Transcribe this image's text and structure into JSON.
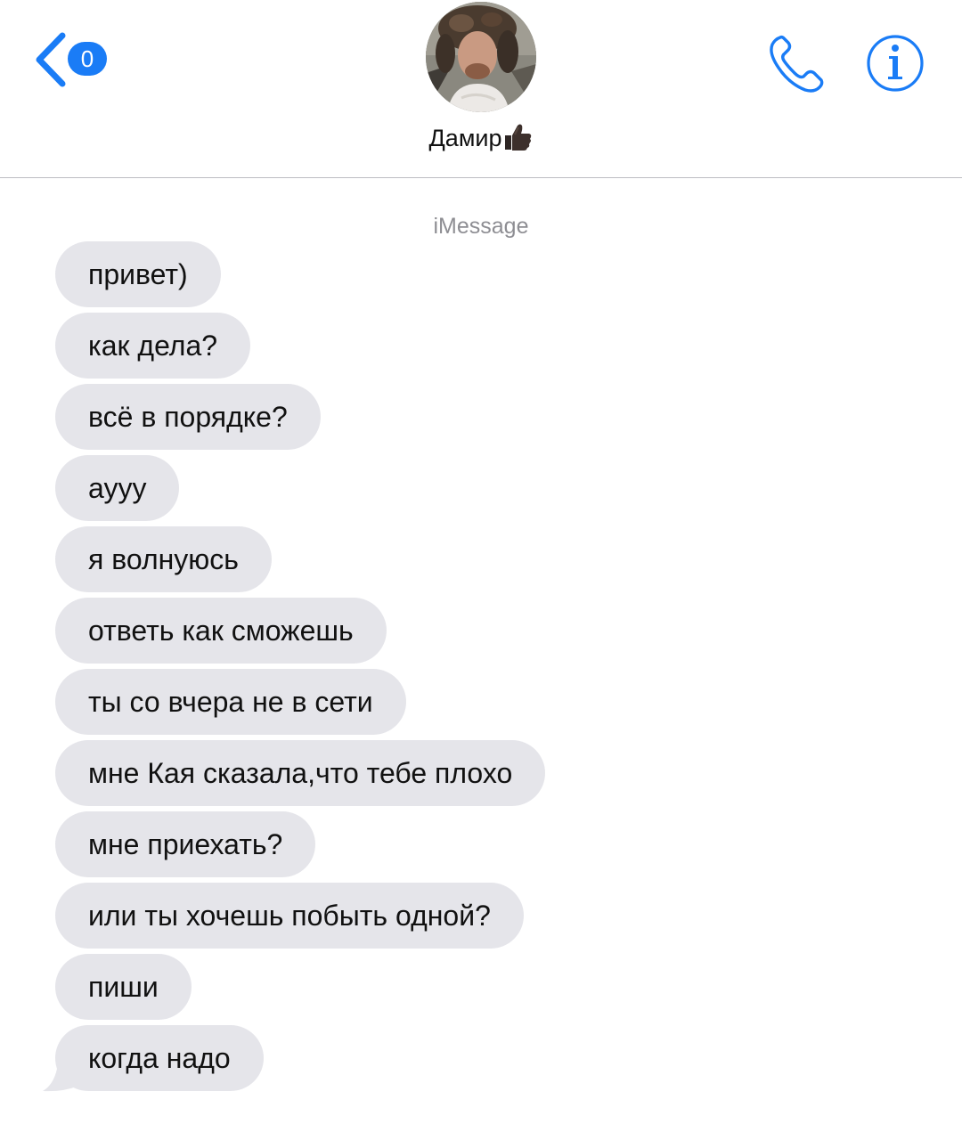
{
  "header": {
    "back_badge": "0",
    "contact_name": "Дамир"
  },
  "conversation": {
    "service_label": "iMessage",
    "messages": [
      "привет)",
      "как дела?",
      "всё в порядке?",
      "аууу",
      "я волнуюсь",
      "ответь как сможешь",
      "ты со вчера не в сети",
      "мне Кая сказала,что тебе плохо",
      "мне приехать?",
      "или ты хочешь побыть одной?",
      "пиши",
      "когда надо"
    ]
  },
  "colors": {
    "accent": "#1a7cf6",
    "bubble_incoming": "#e5e5ea",
    "service_label": "#8e8e93"
  },
  "icons": {
    "back": "chevron-left-icon",
    "call": "phone-icon",
    "info": "info-icon",
    "emoji": "thumbs-up-icon"
  }
}
